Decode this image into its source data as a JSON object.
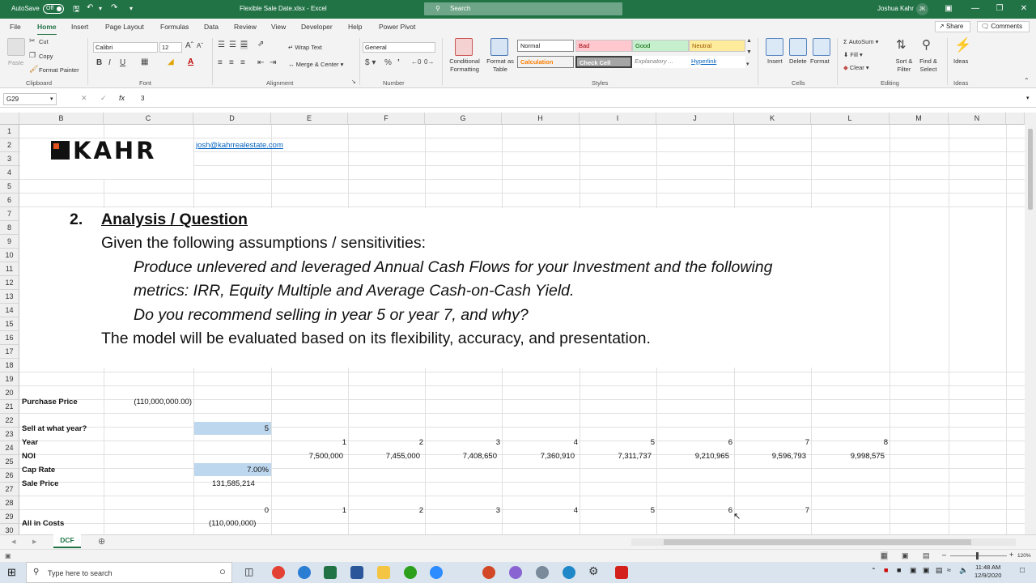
{
  "titlebar": {
    "autosave_label": "AutoSave",
    "autosave_state": "Off",
    "file_title": "Flexible Sale Date.xlsx  -  Excel",
    "search_placeholder": "Search",
    "user_name": "Joshua Kahr",
    "user_initials": "JK"
  },
  "ribbon_tabs": [
    "File",
    "Home",
    "Insert",
    "Page Layout",
    "Formulas",
    "Data",
    "Review",
    "View",
    "Developer",
    "Help",
    "Power Pivot"
  ],
  "share_label": "Share",
  "comments_label": "Comments",
  "ribbon": {
    "clipboard": {
      "paste": "Paste",
      "cut": "Cut",
      "copy": "Copy",
      "format_painter": "Format Painter",
      "label": "Clipboard"
    },
    "font": {
      "name": "Calibri",
      "size": "12",
      "label": "Font",
      "bold": "B",
      "italic": "I",
      "underline": "U"
    },
    "alignment": {
      "wrap": "Wrap Text",
      "merge": "Merge & Center",
      "label": "Alignment"
    },
    "number": {
      "format": "General",
      "label": "Number"
    },
    "styles": {
      "conditional": "Conditional Formatting",
      "format_table": "Format as Table",
      "normal": "Normal",
      "bad": "Bad",
      "good": "Good",
      "neutral": "Neutral",
      "calculation": "Calculation",
      "check_cell": "Check Cell",
      "explanatory": "Explanatory ...",
      "hyperlink": "Hyperlink",
      "label": "Styles"
    },
    "cells": {
      "insert": "Insert",
      "delete": "Delete",
      "format": "Format",
      "label": "Cells"
    },
    "editing": {
      "autosum": "AutoSum",
      "fill": "Fill",
      "clear": "Clear",
      "sort": "Sort & Filter",
      "find": "Find & Select",
      "label": "Editing"
    },
    "ideas": {
      "ideas": "Ideas",
      "label": "Ideas"
    }
  },
  "formula_bar": {
    "name_box": "G29",
    "value": "3"
  },
  "columns": [
    "B",
    "C",
    "D",
    "E",
    "F",
    "G",
    "H",
    "I",
    "J",
    "K",
    "L",
    "M",
    "N"
  ],
  "rows": [
    "1",
    "2",
    "3",
    "4",
    "5",
    "6",
    "7",
    "8",
    "9",
    "10",
    "11",
    "12",
    "13",
    "14",
    "15",
    "16",
    "17",
    "18",
    "19",
    "20",
    "21",
    "22",
    "23",
    "24",
    "25",
    "26",
    "27",
    "28",
    "29",
    "30"
  ],
  "sheet": {
    "logo_text": "KAHR",
    "email": "josh@kahrrealestate.com",
    "heading_num": "2.",
    "heading": "Analysis / Question",
    "line1": "Given the following assumptions / sensitivities:",
    "line2": "Produce unlevered and leveraged Annual Cash Flows for your Investment and the following",
    "line3": "metrics: IRR, Equity Multiple and Average Cash-on-Cash Yield.",
    "line4": "Do you recommend selling in year 5 or year 7, and why?",
    "line5": "The model will be evaluated based on its flexibility, accuracy, and presentation.",
    "purchase_price_label": "Purchase Price",
    "purchase_price": "(110,000,000.00)",
    "sell_label": "Sell at what year?",
    "sell_year": "5",
    "year_label": "Year",
    "years": [
      "1",
      "2",
      "3",
      "4",
      "5",
      "6",
      "7",
      "8"
    ],
    "noi_label": "NOI",
    "noi": [
      "7,500,000",
      "7,455,000",
      "7,408,650",
      "7,360,910",
      "7,311,737",
      "9,210,965",
      "9,596,793",
      "9,998,575"
    ],
    "cap_rate_label": "Cap Rate",
    "cap_rate": "7.00%",
    "sale_price_label": "Sale Price",
    "sale_price": "131,585,214",
    "row29": [
      "0",
      "1",
      "2",
      "3",
      "4",
      "5",
      "6",
      "7"
    ],
    "all_in_label": "All in Costs",
    "all_in": "(110,000,000)"
  },
  "sheet_tab": "DCF",
  "status": {
    "zoom": "120%"
  },
  "taskbar": {
    "search_placeholder": "Type here to search",
    "time": "11:48 AM",
    "date": "12/9/2020"
  }
}
